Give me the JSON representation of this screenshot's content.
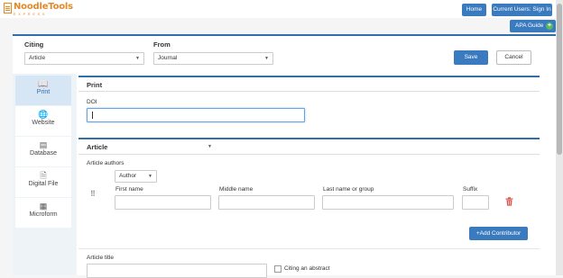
{
  "app": {
    "logo_main": "NoodleTools",
    "logo_sub": "EXPRESS",
    "home_label": "Home",
    "signin_label": "Current Users: Sign In",
    "guide_label": "APA Guide",
    "guide_plus": "+"
  },
  "form": {
    "citing_label": "Citing",
    "citing_value": "Article",
    "from_label": "From",
    "from_value": "Journal",
    "save_label": "Save",
    "cancel_label": "Cancel"
  },
  "sidebar": {
    "items": [
      {
        "label": "Print",
        "icon": "book-icon",
        "glyph": "📖",
        "active": true
      },
      {
        "label": "Website",
        "icon": "globe-icon",
        "glyph": "🌐",
        "active": false
      },
      {
        "label": "Database",
        "icon": "database-icon",
        "glyph": "▤",
        "active": false
      },
      {
        "label": "Digital File",
        "icon": "file-icon",
        "glyph": "🗎",
        "active": false
      },
      {
        "label": "Microform",
        "icon": "microform-icon",
        "glyph": "▦",
        "active": false
      }
    ]
  },
  "print_section": {
    "title": "Print",
    "doi_label": "DOI",
    "doi_value": ""
  },
  "article_section": {
    "type_value": "Article",
    "authors_label": "Article authors",
    "role_value": "Author",
    "first_name_label": "First name",
    "middle_name_label": "Middle name",
    "last_name_label": "Last name or group",
    "suffix_label": "Suffix",
    "add_contributor_label": "+Add Contributor",
    "article_title_label": "Article title",
    "abstract_label": "Citing an abstract"
  },
  "colors": {
    "accent": "#3a7abf",
    "logo": "#e08a2a",
    "delete": "#d9534f"
  }
}
